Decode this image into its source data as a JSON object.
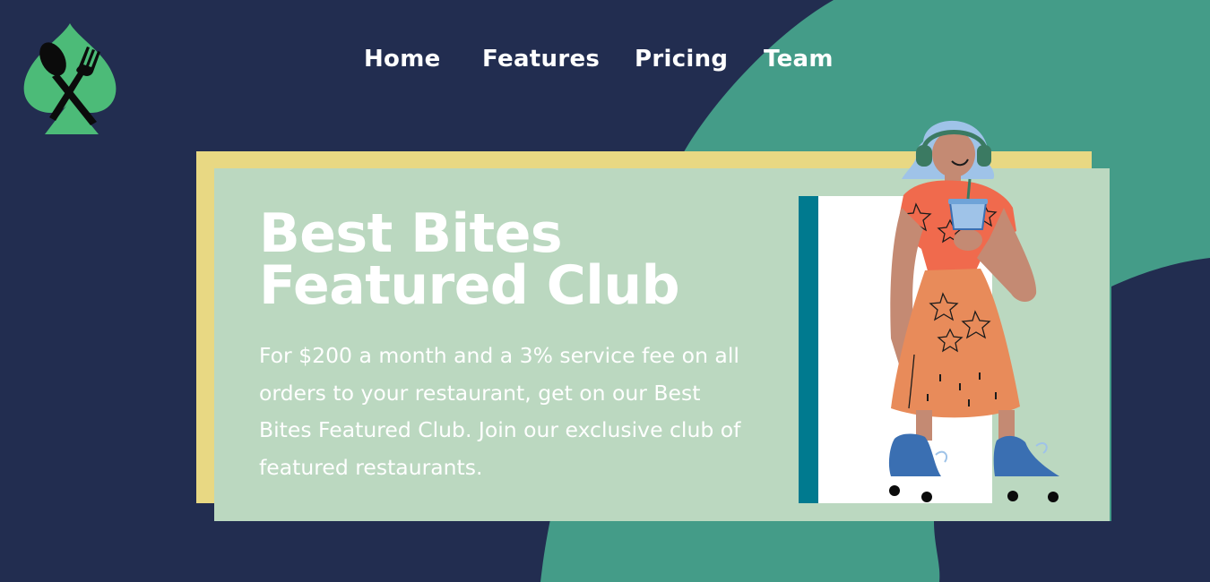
{
  "colors": {
    "background": "#222d50",
    "accent_green": "#449c88",
    "card_back": "#e8d883",
    "card": "#bbd8c0",
    "teal_frame": "#007a8f",
    "logo_green": "#4cbb78"
  },
  "nav": {
    "items": [
      {
        "label": "Home"
      },
      {
        "label": "Features"
      },
      {
        "label": "Pricing"
      },
      {
        "label": "Team"
      }
    ]
  },
  "hero": {
    "title_line1": "Best Bites",
    "title_line2": "Featured Club",
    "description": "For $200 a month and a 3% service fee on all orders to your restaurant, get on our Best Bites Featured Club. Join our exclusive club of featured restaurants."
  },
  "icons": {
    "logo": "spade-spoon-fork-logo",
    "illustration": "person-with-headphones-drink-roller-skates"
  }
}
